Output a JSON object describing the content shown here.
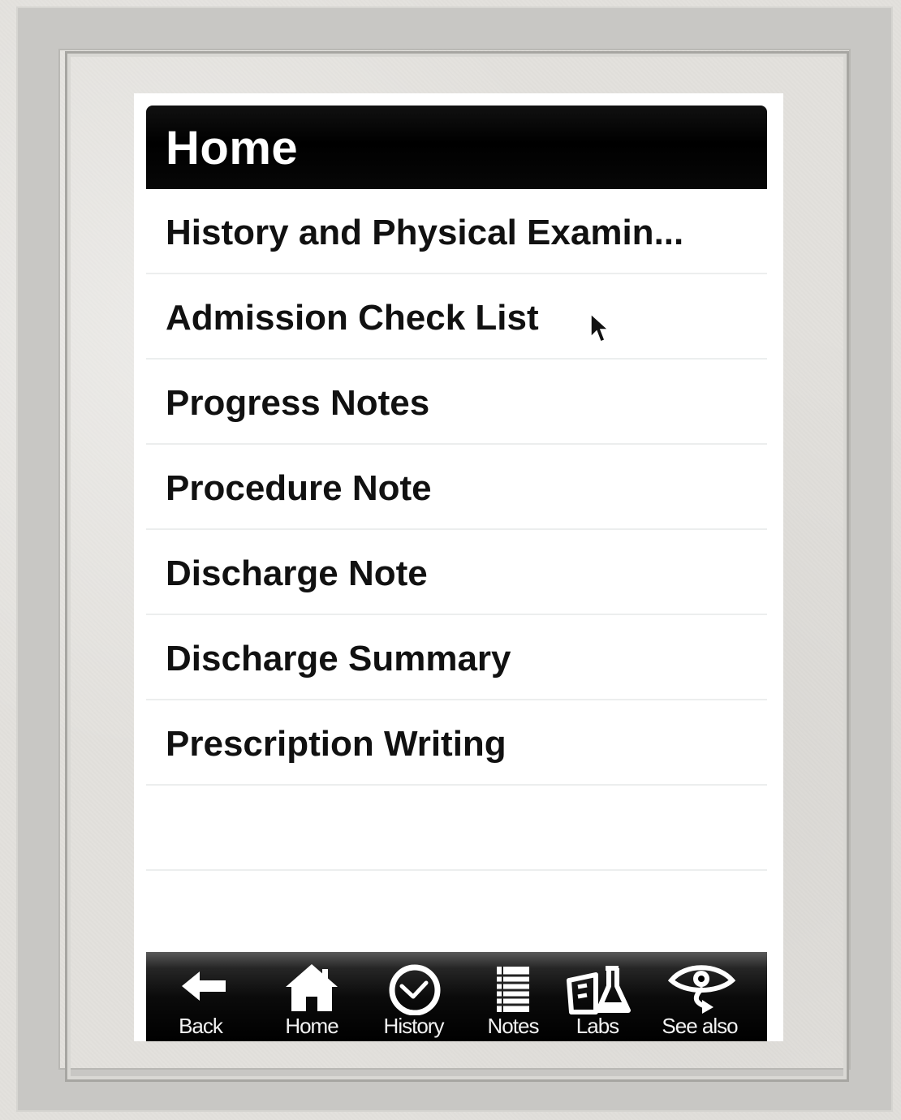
{
  "screen": {
    "title": "Home"
  },
  "menu": {
    "items": [
      {
        "label": "History and Physical Examin..."
      },
      {
        "label": "Admission Check List"
      },
      {
        "label": "Progress Notes"
      },
      {
        "label": "Procedure Note"
      },
      {
        "label": "Discharge Note"
      },
      {
        "label": "Discharge Summary"
      },
      {
        "label": "Prescription Writing"
      },
      {
        "label": ""
      },
      {
        "label": ""
      }
    ]
  },
  "tabbar": {
    "tabs": [
      {
        "label": "Back",
        "icon": "back-arrow-icon"
      },
      {
        "label": "Home",
        "icon": "home-icon"
      },
      {
        "label": "History",
        "icon": "clock-icon"
      },
      {
        "label": "Notes",
        "icon": "notes-icon"
      },
      {
        "label": "Labs",
        "icon": "labs-flask-icon"
      },
      {
        "label": "See also",
        "icon": "eye-icon"
      }
    ]
  },
  "colors": {
    "titlebar": "#000000",
    "list_background": "#ffffff",
    "separator": "#eceeee",
    "tabbar": "#000000",
    "frame": "#c8c7c4"
  }
}
